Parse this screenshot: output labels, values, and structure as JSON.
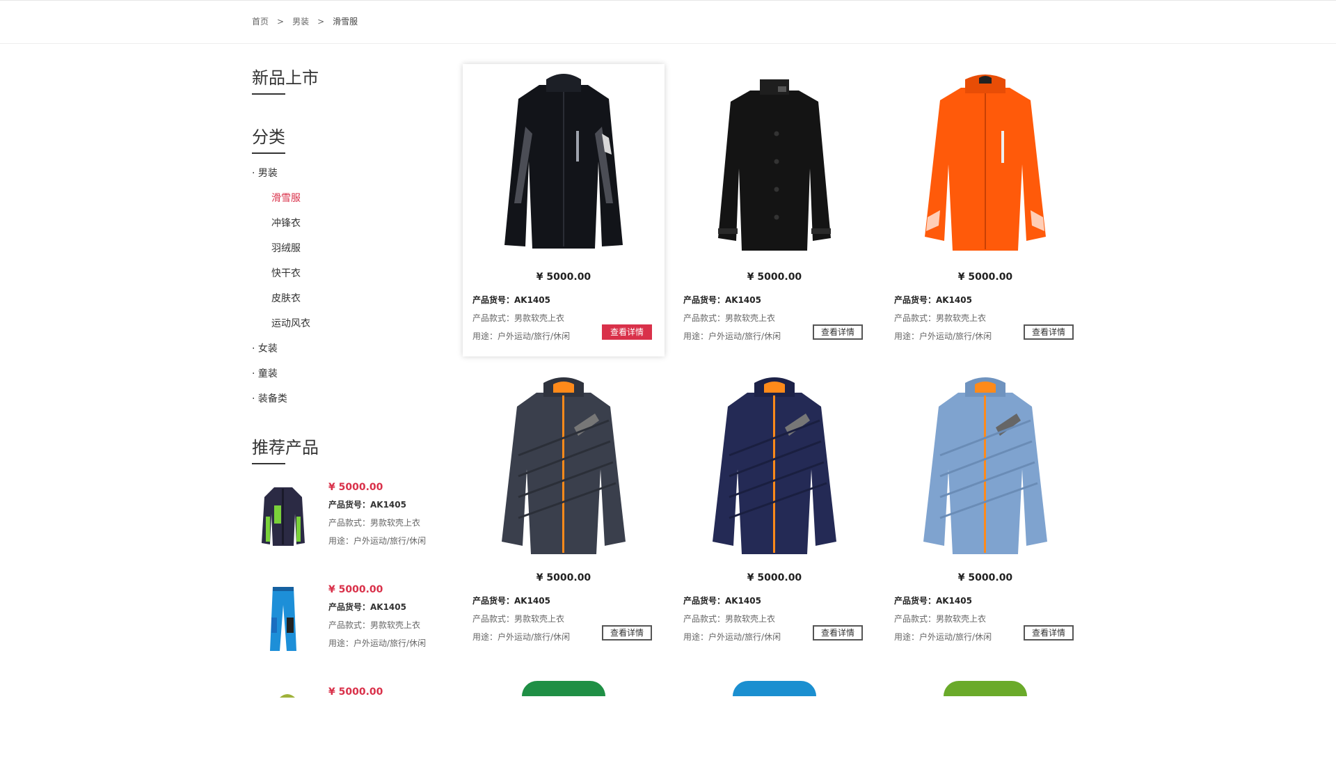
{
  "breadcrumb": {
    "home": "首页",
    "men": "男装",
    "current": "滑雪服",
    "sep": ">"
  },
  "sidebar": {
    "new_title": "新品上市",
    "category_title": "分类",
    "categories": {
      "men": "· 男装",
      "ski": "滑雪服",
      "storm": "冲锋衣",
      "down": "羽绒服",
      "quickdry": "快干衣",
      "skin": "皮肤衣",
      "windbreaker": "运动风衣",
      "women": "· 女装",
      "kids": "· 童装",
      "gear": "· 装备类"
    },
    "recommend_title": "推荐产品",
    "recommend": [
      {
        "price": "¥ 5000.00",
        "code": "产品货号：AK1405",
        "style": "产品款式：男款软壳上衣",
        "use": "用途：户外运动/旅行/休闲"
      },
      {
        "price": "¥ 5000.00",
        "code": "产品货号：AK1405",
        "style": "产品款式：男款软壳上衣",
        "use": "用途：户外运动/旅行/休闲"
      },
      {
        "price": "¥ 5000.00"
      }
    ]
  },
  "products": [
    {
      "price": "¥ 5000.00",
      "code": "产品货号：AK1405",
      "style": "产品款式：男款软壳上衣",
      "use": "用途：户外运动/旅行/休闲",
      "button": "查看详情",
      "color": "#111418"
    },
    {
      "price": "¥ 5000.00",
      "code": "产品货号：AK1405",
      "style": "产品款式：男款软壳上衣",
      "use": "用途：户外运动/旅行/休闲",
      "button": "查看详情",
      "color": "#1a1a1a"
    },
    {
      "price": "¥ 5000.00",
      "code": "产品货号：AK1405",
      "style": "产品款式：男款软壳上衣",
      "use": "用途：户外运动/旅行/休闲",
      "button": "查看详情",
      "color": "#ff5a0a"
    },
    {
      "price": "¥ 5000.00",
      "code": "产品货号：AK1405",
      "style": "产品款式：男款软壳上衣",
      "use": "用途：户外运动/旅行/休闲",
      "button": "查看详情",
      "color": "#3a3f4c"
    },
    {
      "price": "¥ 5000.00",
      "code": "产品货号：AK1405",
      "style": "产品款式：男款软壳上衣",
      "use": "用途：户外运动/旅行/休闲",
      "button": "查看详情",
      "color": "#242a55"
    },
    {
      "price": "¥ 5000.00",
      "code": "产品货号：AK1405",
      "style": "产品款式：男款软壳上衣",
      "use": "用途：户外运动/旅行/休闲",
      "button": "查看详情",
      "color": "#7fa3cf"
    }
  ],
  "colors": {
    "accent": "#d9314a"
  }
}
